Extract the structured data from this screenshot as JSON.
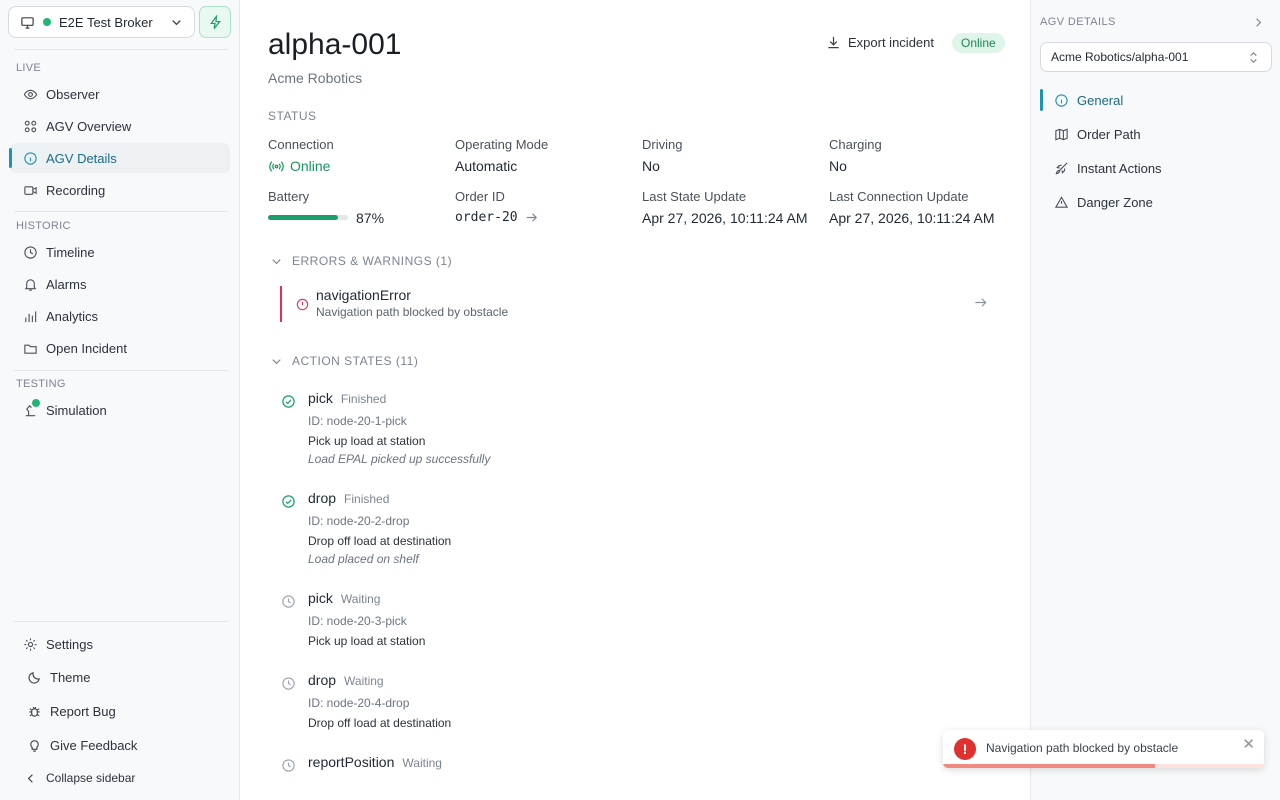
{
  "sidebar": {
    "broker": "E2E Test Broker",
    "groups": {
      "live": "LIVE",
      "historic": "HISTORIC",
      "testing": "TESTING"
    },
    "items": {
      "observer": "Observer",
      "overview": "AGV Overview",
      "details": "AGV Details",
      "recording": "Recording",
      "timeline": "Timeline",
      "alarms": "Alarms",
      "analytics": "Analytics",
      "incident": "Open Incident",
      "simulation": "Simulation"
    },
    "footer": {
      "settings": "Settings",
      "theme": "Theme",
      "bug": "Report Bug",
      "feedback": "Give Feedback",
      "collapse": "Collapse sidebar"
    }
  },
  "main": {
    "title": "alpha-001",
    "subtitle": "Acme Robotics",
    "export": "Export incident",
    "status_pill": "Online",
    "status_heading": "STATUS",
    "fields": {
      "connection_label": "Connection",
      "connection_value": "Online",
      "mode_label": "Operating Mode",
      "mode_value": "Automatic",
      "driving_label": "Driving",
      "driving_value": "No",
      "charging_label": "Charging",
      "charging_value": "No",
      "battery_label": "Battery",
      "battery_value": "87%",
      "battery_fraction": 0.87,
      "order_label": "Order ID",
      "order_value": "order-20",
      "state_label": "Last State Update",
      "state_value": "Apr 27, 2026, 10:11:24 AM",
      "conn_update_label": "Last Connection Update",
      "conn_update_value": "Apr 27, 2026, 10:11:24 AM"
    },
    "errors_heading": "ERRORS & WARNINGS (1)",
    "error": {
      "title": "navigationError",
      "description": "Navigation path blocked by obstacle"
    },
    "actions_heading": "ACTION STATES (11)",
    "actions": [
      {
        "name": "pick",
        "status": "Finished",
        "id": "ID: node-20-1-pick",
        "description": "Pick up load at station",
        "result": "Load EPAL picked up successfully"
      },
      {
        "name": "drop",
        "status": "Finished",
        "id": "ID: node-20-2-drop",
        "description": "Drop off load at destination",
        "result": "Load placed on shelf"
      },
      {
        "name": "pick",
        "status": "Waiting",
        "id": "ID: node-20-3-pick",
        "description": "Pick up load at station"
      },
      {
        "name": "drop",
        "status": "Waiting",
        "id": "ID: node-20-4-drop",
        "description": "Drop off load at destination"
      },
      {
        "name": "reportPosition",
        "status": "Waiting"
      }
    ]
  },
  "right": {
    "heading": "AGV DETAILS",
    "select_value": "Acme Robotics/alpha-001",
    "items": {
      "general": "General",
      "order_path": "Order Path",
      "instant_actions": "Instant Actions",
      "danger_zone": "Danger Zone"
    }
  },
  "toast": {
    "message": "Navigation path blocked by obstacle",
    "progress": 0.66
  },
  "colors": {
    "accent": "#1e94b3",
    "success": "#19a06a",
    "error": "#e03131"
  }
}
